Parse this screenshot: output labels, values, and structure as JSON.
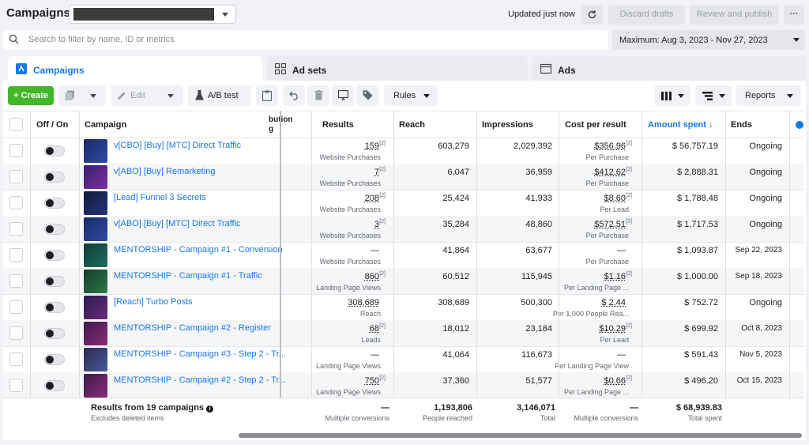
{
  "header": {
    "title": "Campaigns",
    "updated_text": "Updated just now",
    "discard_label": "Discard drafts",
    "review_label": "Review and publish",
    "more_label": "···"
  },
  "search": {
    "placeholder": "Search to filter by name, ID or metrics"
  },
  "date_range": {
    "label": "Maximum: Aug 3, 2023 - Nov 27, 2023"
  },
  "tabs": [
    {
      "label": "Campaigns",
      "active": true
    },
    {
      "label": "Ad sets",
      "active": false
    },
    {
      "label": "Ads",
      "active": false
    }
  ],
  "toolbar": {
    "create_label": "Create",
    "edit_label": "Edit",
    "ab_label": "A/B test",
    "rules_label": "Rules",
    "reports_label": "Reports"
  },
  "columns": {
    "off_on": "Off / On",
    "campaign": "Campaign",
    "attribution": "bution\ng",
    "results": "Results",
    "reach": "Reach",
    "impressions": "Impressions",
    "cost_per_result": "Cost per result",
    "amount_spent": "Amount spent ↓",
    "ends": "Ends"
  },
  "rows": [
    {
      "name": "v[CBO] [Buy] [MTC] Direct Traffic",
      "results": "159",
      "results_sup": "[2]",
      "results_type": "Website Purchases",
      "reach": "603,279",
      "impressions": "2,029,392",
      "cpr": "$356.96",
      "cpr_sup": "[2]",
      "cpr_type": "Per Purchase",
      "spent": "$ 56,757.19",
      "ends": "Ongoing"
    },
    {
      "name": "v[ABO] [Buy] Remarketing",
      "results": "7",
      "results_sup": "[2]",
      "results_type": "Website Purchases",
      "reach": "6,047",
      "impressions": "36,959",
      "cpr": "$412.62",
      "cpr_sup": "[2]",
      "cpr_type": "Per Purchase",
      "spent": "$ 2,888.31",
      "ends": "Ongoing"
    },
    {
      "name": "[Lead] Funnel 3 Secrets",
      "results": "208",
      "results_sup": "[2]",
      "results_type": "Website Purchases",
      "reach": "25,424",
      "impressions": "41,933",
      "cpr": "$8.60",
      "cpr_sup": "[2]",
      "cpr_type": "Per Lead",
      "spent": "$ 1,788.48",
      "ends": "Ongoing"
    },
    {
      "name": "v[ABO] [Buy] [MTC] Direct Traffic",
      "results": "3",
      "results_sup": "[2]",
      "results_type": "Website Purchases",
      "reach": "35,284",
      "impressions": "48,860",
      "cpr": "$572.51",
      "cpr_sup": "[2]",
      "cpr_type": "Per Purchase",
      "spent": "$ 1,717.53",
      "ends": "Ongoing"
    },
    {
      "name": "MENTORSHIP - Campaign #1 - Conversion",
      "results": "—",
      "results_sup": "",
      "results_type": "Website Purchases",
      "reach": "41,864",
      "impressions": "63,677",
      "cpr": "—",
      "cpr_sup": "",
      "cpr_type": "Per Purchase",
      "spent": "$ 1,093.87",
      "ends": "Sep 22, 2023"
    },
    {
      "name": "MENTORSHIP - Campaign #1 - Traffic",
      "results": "860",
      "results_sup": "[2]",
      "results_type": "Landing Page Views",
      "reach": "60,512",
      "impressions": "115,945",
      "cpr": "$1.16",
      "cpr_sup": "[2]",
      "cpr_type": "Per Landing Page ...",
      "spent": "$ 1,000.00",
      "ends": "Sep 18, 2023"
    },
    {
      "name": "[Reach] Turbo Posts",
      "results": "308,689",
      "results_sup": "",
      "results_type": "Reach",
      "reach": "308,689",
      "impressions": "500,300",
      "cpr": "$ 2.44",
      "cpr_sup": "",
      "cpr_type": "Per 1,000 People Rea...",
      "spent": "$ 752.72",
      "ends": "Ongoing"
    },
    {
      "name": "MENTORSHIP - Campaign #2 - Register",
      "results": "68",
      "results_sup": "[2]",
      "results_type": "Leads",
      "reach": "18,012",
      "impressions": "23,184",
      "cpr": "$10.29",
      "cpr_sup": "[2]",
      "cpr_type": "Per Lead",
      "spent": "$ 699.92",
      "ends": "Oct 8, 2023"
    },
    {
      "name": "MENTORSHIP - Campaign #3 - Step 2 - Tr...",
      "results": "—",
      "results_sup": "",
      "results_type": "Landing Page Views",
      "reach": "41,064",
      "impressions": "116,673",
      "cpr": "—",
      "cpr_sup": "",
      "cpr_type": "Per Landing Page View",
      "spent": "$ 591.43",
      "ends": "Nov 5, 2023"
    },
    {
      "name": "MENTORSHIP - Campaign #2 - Step 2 - Tr...",
      "results": "750",
      "results_sup": "[2]",
      "results_type": "Landing Page Views",
      "reach": "37,360",
      "impressions": "51,577",
      "cpr": "$0.66",
      "cpr_sup": "[2]",
      "cpr_type": "Per Landing Page ...",
      "spent": "$ 496.20",
      "ends": "Oct 15, 2023"
    }
  ],
  "footer": {
    "title": "Results from 19 campaigns",
    "subtitle": "Excludes deleted items",
    "results": "—",
    "results_sub": "Multiple conversions",
    "reach": "1,193,806",
    "reach_sub": "People reached",
    "impressions": "3,146,071",
    "impressions_sub": "Total",
    "cpr": "—",
    "cpr_sub": "Multiple conversions",
    "spent": "$ 68,939.83",
    "spent_sub": "Total spent"
  },
  "colors": {
    "accent": "#1877f2",
    "create": "#42b72a"
  }
}
